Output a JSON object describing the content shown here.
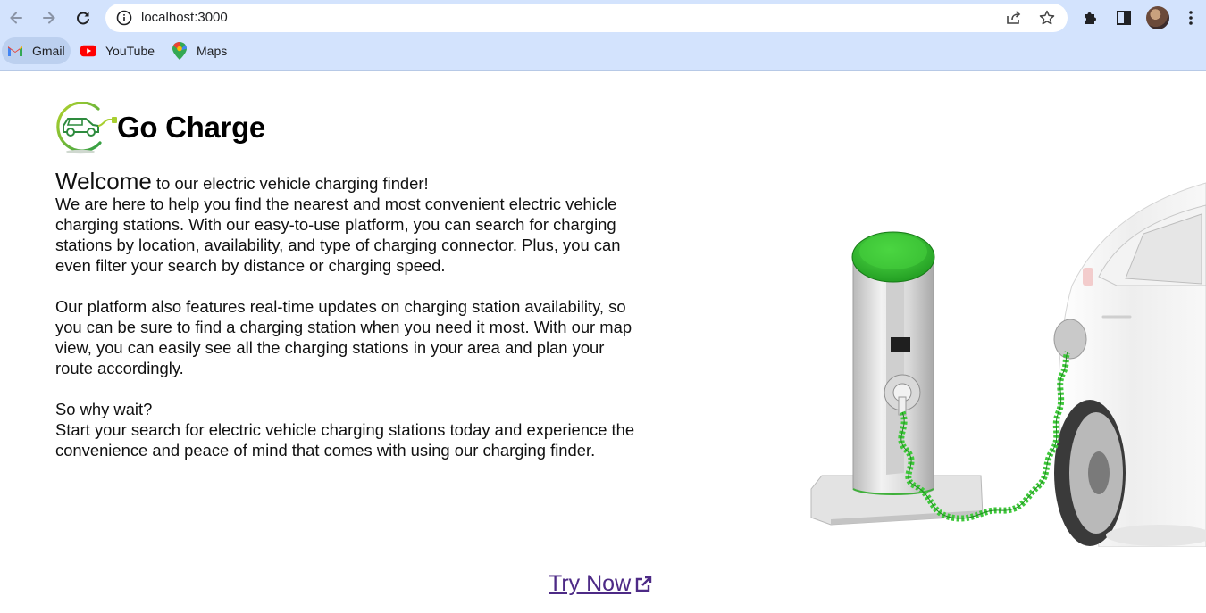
{
  "browser": {
    "url": "localhost:3000",
    "bookmarks": [
      {
        "label": "Gmail",
        "icon": "gmail-icon"
      },
      {
        "label": "YouTube",
        "icon": "youtube-icon"
      },
      {
        "label": "Maps",
        "icon": "maps-icon"
      }
    ]
  },
  "header": {
    "brand": "Go Charge"
  },
  "main": {
    "welcome_word": "Welcome",
    "welcome_rest": " to our electric vehicle charging finder!",
    "para1": "We are here to help you find the nearest and most convenient electric vehicle charging stations. With our easy-to-use platform, you can search for charging stations by location, availability, and type of charging connector. Plus, you can even filter your search by distance or charging speed.",
    "para2": "Our platform also features real-time updates on charging station availability, so you can be sure to find a charging station when you need it most. With our map view, you can easily see all the charging stations in your area and plan your route accordingly.",
    "para3a": "So why wait?",
    "para3b": "Start your search for electric vehicle charging stations today and experience the convenience and peace of mind that comes with using our charging finder."
  },
  "cta": {
    "label": "Try Now"
  },
  "colors": {
    "chrome": "#d3e3fd",
    "link": "#4d2a86",
    "accent_green": "#3cb43c"
  }
}
